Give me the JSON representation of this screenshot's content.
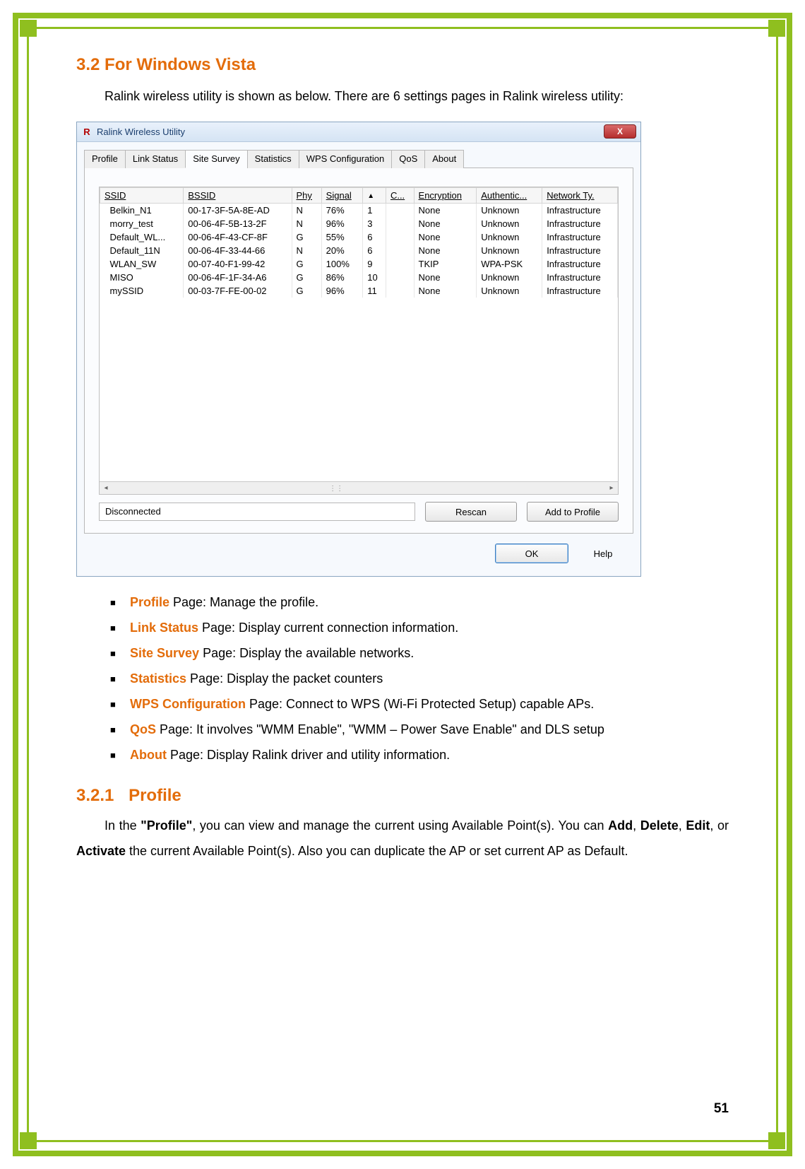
{
  "section": {
    "number": "3.2",
    "title": "For Windows Vista"
  },
  "intro": "Ralink wireless utility is shown as below. There are 6 settings pages in Ralink wireless utility:",
  "window": {
    "title": "Ralink Wireless Utility",
    "icon_text": "R",
    "close_glyph": "X",
    "tabs": [
      "Profile",
      "Link Status",
      "Site Survey",
      "Statistics",
      "WPS Configuration",
      "QoS",
      "About"
    ],
    "active_tab_index": 2,
    "columns": [
      "SSID",
      "BSSID",
      "Phy",
      "Signal",
      "▲",
      "C...",
      "Encryption",
      "Authentic...",
      "Network Ty."
    ],
    "rows": [
      {
        "ssid": "Belkin_N1",
        "bssid": "00-17-3F-5A-8E-AD",
        "phy": "N",
        "signal": "76%",
        "col5": "1",
        "enc": "None",
        "auth": "Unknown",
        "net": "Infrastructure"
      },
      {
        "ssid": "morry_test",
        "bssid": "00-06-4F-5B-13-2F",
        "phy": "N",
        "signal": "96%",
        "col5": "3",
        "enc": "None",
        "auth": "Unknown",
        "net": "Infrastructure"
      },
      {
        "ssid": "Default_WL...",
        "bssid": "00-06-4F-43-CF-8F",
        "phy": "G",
        "signal": "55%",
        "col5": "6",
        "enc": "None",
        "auth": "Unknown",
        "net": "Infrastructure"
      },
      {
        "ssid": "Default_11N",
        "bssid": "00-06-4F-33-44-66",
        "phy": "N",
        "signal": "20%",
        "col5": "6",
        "enc": "None",
        "auth": "Unknown",
        "net": "Infrastructure"
      },
      {
        "ssid": "WLAN_SW",
        "bssid": "00-07-40-F1-99-42",
        "phy": "G",
        "signal": "100%",
        "col5": "9",
        "enc": "TKIP",
        "auth": "WPA-PSK",
        "net": "Infrastructure"
      },
      {
        "ssid": "MISO",
        "bssid": "00-06-4F-1F-34-A6",
        "phy": "G",
        "signal": "86%",
        "col5": "10",
        "enc": "None",
        "auth": "Unknown",
        "net": "Infrastructure"
      },
      {
        "ssid": "mySSID",
        "bssid": "00-03-7F-FE-00-02",
        "phy": "G",
        "signal": "96%",
        "col5": "11",
        "enc": "None",
        "auth": "Unknown",
        "net": "Infrastructure"
      }
    ],
    "status_text": "Disconnected",
    "buttons": {
      "rescan": "Rescan",
      "add_profile": "Add to Profile",
      "ok": "OK",
      "help": "Help"
    },
    "scroll": {
      "left": "◂",
      "right": "▸",
      "thumb": "⋮⋮"
    }
  },
  "features": [
    {
      "label": "Profile",
      "desc": " Page: Manage the profile."
    },
    {
      "label": "Link Status",
      "desc": " Page: Display current connection information."
    },
    {
      "label": "Site Survey",
      "desc": " Page: Display the available networks."
    },
    {
      "label": "Statistics",
      "desc": " Page: Display the packet counters"
    },
    {
      "label": "WPS Configuration",
      "desc": " Page: Connect to WPS (Wi-Fi Protected Setup) capable APs."
    },
    {
      "label": "QoS",
      "desc": " Page: It involves \"WMM Enable\", \"WMM – Power Save Enable\" and DLS setup"
    },
    {
      "label": "About",
      "desc": " Page: Display Ralink driver and utility information."
    }
  ],
  "subsection": {
    "number": "3.2.1",
    "title": "Profile"
  },
  "subsection_body_parts": {
    "p1a": "In the ",
    "p1b": "\"Profile\"",
    "p1c": ", you can view and manage the current using Available Point(s). You can ",
    "p2a": "Add",
    "p2b": ", ",
    "p2c": "Delete",
    "p2d": ", ",
    "p2e": "Edit",
    "p2f": ", or ",
    "p2g": "Activate",
    "p2h": " the current Available Point(s). Also you can duplicate the AP or set current AP as Default."
  },
  "page_number": "51"
}
